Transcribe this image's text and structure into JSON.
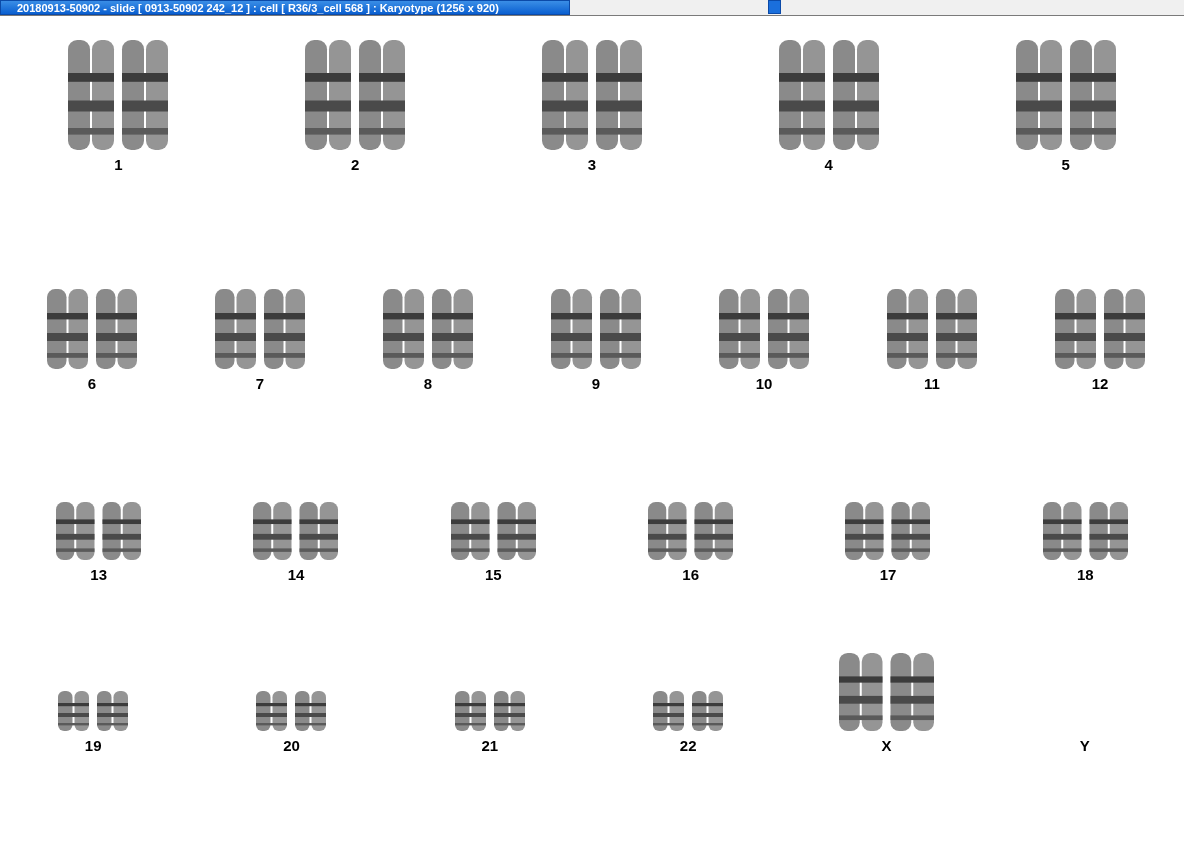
{
  "window": {
    "title": "20180913-50902 - slide [ 0913-50902 242_12 ] : cell [ R36/3_cell 568 ] : Karyotype  (1256 x 920)"
  },
  "karyotype_rows": [
    {
      "items": [
        {
          "label": "1",
          "kind": "autosome"
        },
        {
          "label": "2",
          "kind": "autosome"
        },
        {
          "label": "3",
          "kind": "autosome"
        },
        {
          "label": "4",
          "kind": "autosome"
        },
        {
          "label": "5",
          "kind": "autosome"
        }
      ]
    },
    {
      "items": [
        {
          "label": "6",
          "kind": "autosome"
        },
        {
          "label": "7",
          "kind": "autosome"
        },
        {
          "label": "8",
          "kind": "autosome"
        },
        {
          "label": "9",
          "kind": "autosome"
        },
        {
          "label": "10",
          "kind": "autosome"
        },
        {
          "label": "11",
          "kind": "autosome"
        },
        {
          "label": "12",
          "kind": "autosome"
        }
      ]
    },
    {
      "items": [
        {
          "label": "13",
          "kind": "autosome"
        },
        {
          "label": "14",
          "kind": "autosome"
        },
        {
          "label": "15",
          "kind": "autosome"
        },
        {
          "label": "16",
          "kind": "autosome"
        },
        {
          "label": "17",
          "kind": "autosome"
        },
        {
          "label": "18",
          "kind": "autosome"
        }
      ]
    },
    {
      "items": [
        {
          "label": "19",
          "kind": "autosome"
        },
        {
          "label": "20",
          "kind": "autosome"
        },
        {
          "label": "21",
          "kind": "autosome"
        },
        {
          "label": "22",
          "kind": "autosome"
        },
        {
          "label": "X",
          "kind": "sex"
        },
        {
          "label": "Y",
          "kind": "missing"
        }
      ]
    }
  ]
}
